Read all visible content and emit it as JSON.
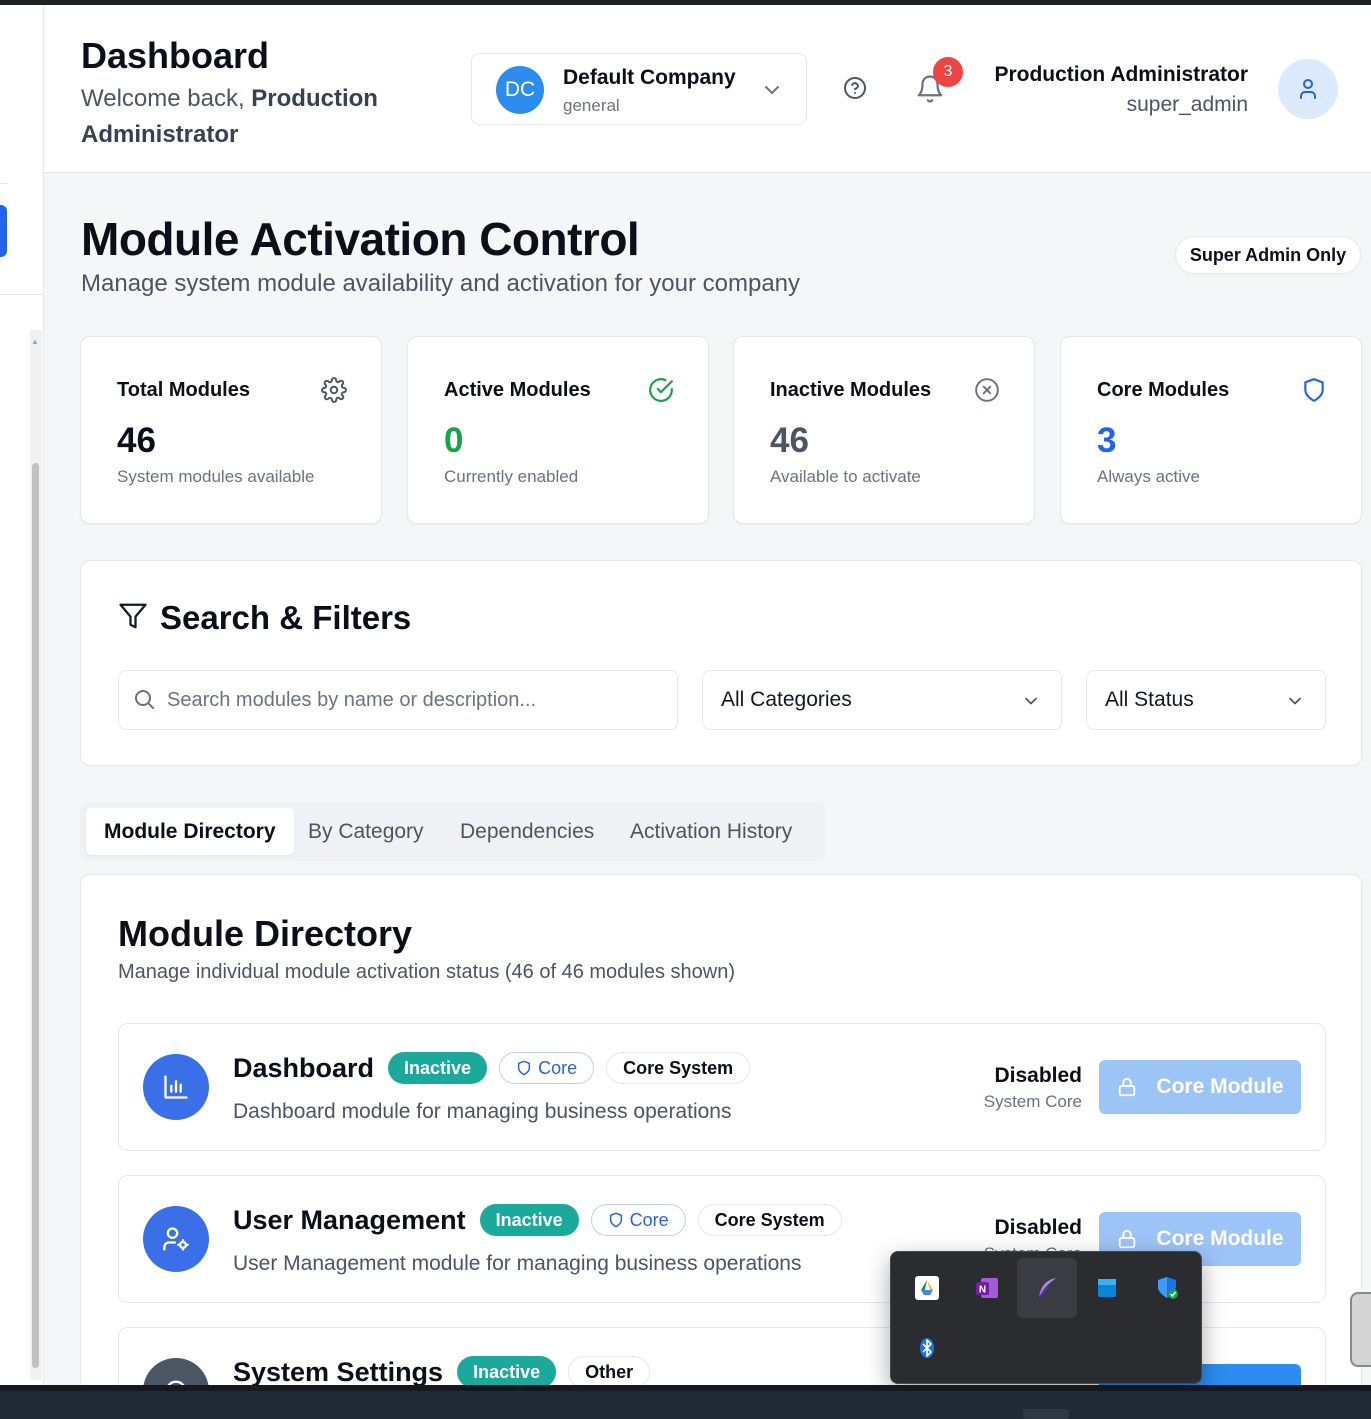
{
  "header": {
    "title": "Dashboard",
    "welcome_prefix": "Welcome back,",
    "welcome_name": "Production Administrator",
    "company": {
      "initials": "DC",
      "name": "Default Company",
      "type": "general"
    },
    "notifications_count": "3",
    "user": {
      "name": "Production Administrator",
      "role": "super_admin"
    }
  },
  "page": {
    "title": "Module Activation Control",
    "subtitle": "Manage system module availability and activation for your company",
    "badge": "Super Admin Only"
  },
  "stats": [
    {
      "label": "Total Modules",
      "value": "46",
      "caption": "System modules available",
      "icon": "gear-icon",
      "color": "#111827"
    },
    {
      "label": "Active Modules",
      "value": "0",
      "caption": "Currently enabled",
      "icon": "check-circle-icon",
      "color": "#16a34a"
    },
    {
      "label": "Inactive Modules",
      "value": "46",
      "caption": "Available to activate",
      "icon": "x-circle-icon",
      "color": "#4b5563"
    },
    {
      "label": "Core Modules",
      "value": "3",
      "caption": "Always active",
      "icon": "shield-icon",
      "color": "#2563eb"
    }
  ],
  "filters": {
    "title": "Search & Filters",
    "search_placeholder": "Search modules by name or description...",
    "category_value": "All Categories",
    "status_value": "All Status"
  },
  "tabs": [
    "Module Directory",
    "By Category",
    "Dependencies",
    "Activation History"
  ],
  "directory": {
    "title": "Module Directory",
    "subtitle": "Manage individual module activation status (46 of 46 modules shown)",
    "modules": [
      {
        "name": "Dashboard",
        "status": "Inactive",
        "core": "Core",
        "category": "Core System",
        "description": "Dashboard module for managing business operations",
        "state": "Disabled",
        "state_sub": "System Core",
        "action": "Core Module",
        "icon": "bar-chart-icon"
      },
      {
        "name": "User Management",
        "status": "Inactive",
        "core": "Core",
        "category": "Core System",
        "description": "User Management module for managing business operations",
        "state": "Disabled",
        "state_sub": "System Core",
        "action": "Core Module",
        "icon": "user-cog-icon"
      },
      {
        "name": "System Settings",
        "status": "Inactive",
        "category": "Other",
        "icon": "gear-icon"
      }
    ]
  },
  "colors": {
    "accent": "#2563eb",
    "inactive_badge": "#1aa99a",
    "core_button_disabled": "#9dc4f7",
    "notification": "#ef4444"
  },
  "tray_icons": [
    "google-drive-icon",
    "onenote-icon",
    "feather-icon",
    "windows-app-icon",
    "defender-shield-icon",
    "bluetooth-icon"
  ]
}
